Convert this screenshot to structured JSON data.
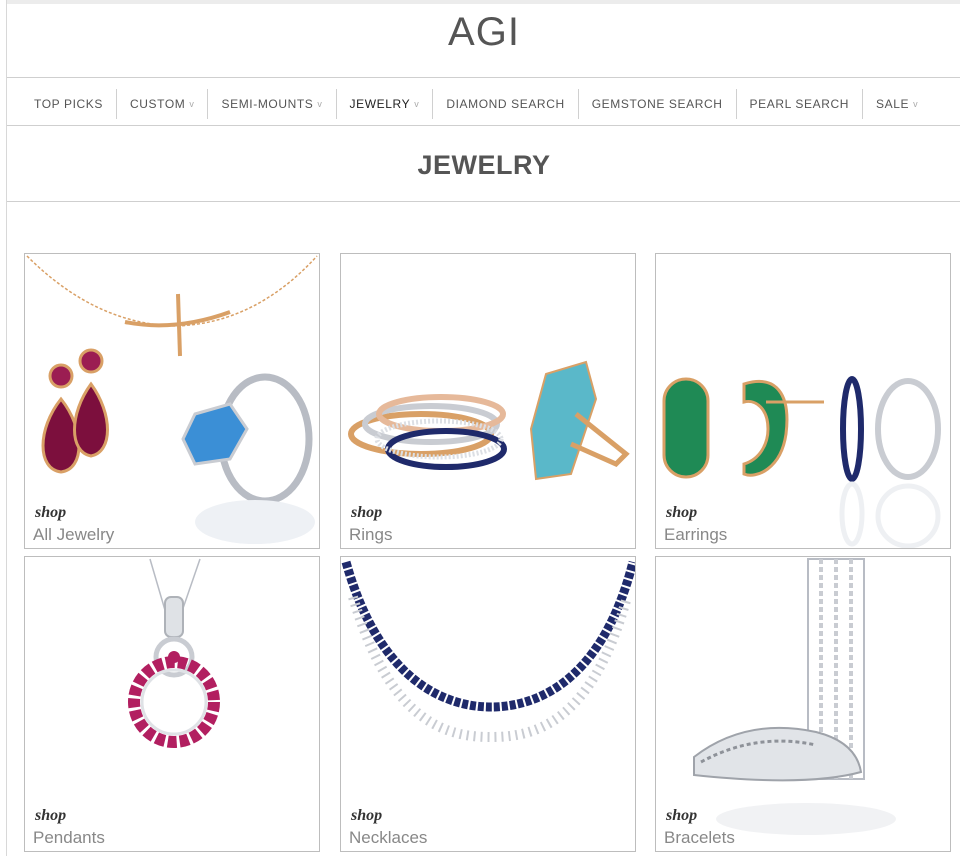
{
  "brand": {
    "logo": "AGI"
  },
  "nav": {
    "items": [
      {
        "label": "TOP PICKS",
        "dropdown": false,
        "active": false
      },
      {
        "label": "CUSTOM",
        "dropdown": true,
        "active": false
      },
      {
        "label": "SEMI-MOUNTS",
        "dropdown": true,
        "active": false
      },
      {
        "label": "JEWELRY",
        "dropdown": true,
        "active": true
      },
      {
        "label": "DIAMOND SEARCH",
        "dropdown": false,
        "active": false
      },
      {
        "label": "GEMSTONE SEARCH",
        "dropdown": false,
        "active": false
      },
      {
        "label": "PEARL SEARCH",
        "dropdown": false,
        "active": false
      },
      {
        "label": "SALE",
        "dropdown": true,
        "active": false
      }
    ],
    "chevron": "v"
  },
  "page": {
    "title": "JEWELRY"
  },
  "categories": [
    {
      "shop": "shop",
      "label": "All Jewelry"
    },
    {
      "shop": "shop",
      "label": "Rings"
    },
    {
      "shop": "shop",
      "label": "Earrings"
    },
    {
      "shop": "shop",
      "label": "Pendants"
    },
    {
      "shop": "shop",
      "label": "Necklaces"
    },
    {
      "shop": "shop",
      "label": "Bracelets"
    }
  ],
  "colors": {
    "gold": "#d9a066",
    "ruby": "#8e1746",
    "topaz": "#3b8fd6",
    "turquoise": "#5ab8c9",
    "emerald": "#1f8a55",
    "sapphire": "#1f2a6b",
    "silver": "#b8bcc4"
  }
}
